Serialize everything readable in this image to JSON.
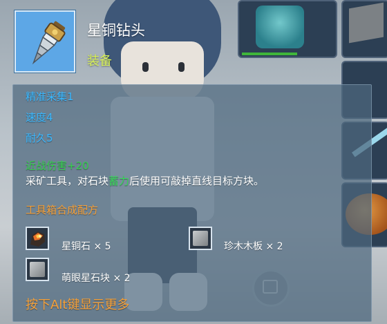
{
  "item": {
    "name": "星铜钻头",
    "type": "装备",
    "icon": "drill-icon"
  },
  "stats": [
    {
      "label": "精准采集1"
    },
    {
      "label": "速度4"
    },
    {
      "label": "耐久5"
    }
  ],
  "melee_damage": "近战伤害+20",
  "description": {
    "before": "采矿工具，对石块",
    "highlight": "蓄力",
    "after": "后使用可敲掉直线目标方块。"
  },
  "recipe": {
    "title": "工具箱合成配方",
    "ingredients": [
      {
        "name": "星铜石 × 5",
        "icon": "star-copper-ore-icon"
      },
      {
        "name": "珍木木板 × 2",
        "icon": "rare-wood-plank-icon"
      },
      {
        "name": "萌眼星石块 × 2",
        "icon": "star-stone-block-icon"
      }
    ]
  },
  "hint": "按下Alt键显示更多",
  "colors": {
    "stat": "#3ab8ff",
    "melee": "#36d14f",
    "highlight": "#38d95a",
    "recipe_title": "#f4a03a",
    "item_type": "#d7f05a"
  }
}
